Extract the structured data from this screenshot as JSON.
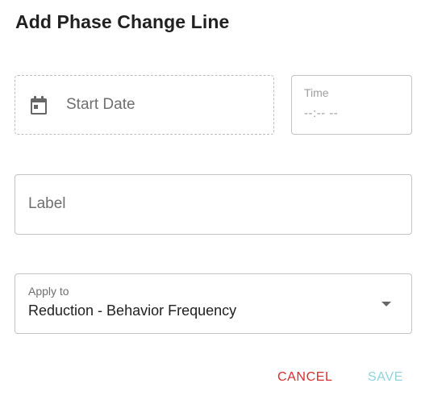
{
  "dialog": {
    "title": "Add Phase Change Line"
  },
  "start_date": {
    "placeholder": "Start Date",
    "icon": "calendar-icon"
  },
  "time": {
    "label": "Time",
    "value": "--:-- --"
  },
  "label_field": {
    "placeholder": "Label"
  },
  "apply_to": {
    "label": "Apply to",
    "selected": "Reduction - Behavior Frequency",
    "icon": "dropdown-arrow-icon"
  },
  "actions": {
    "cancel_label": "CANCEL",
    "save_label": "SAVE"
  },
  "colors": {
    "cancel": "#d32f2f",
    "save_disabled": "#8fd3de",
    "icon": "#666666"
  }
}
